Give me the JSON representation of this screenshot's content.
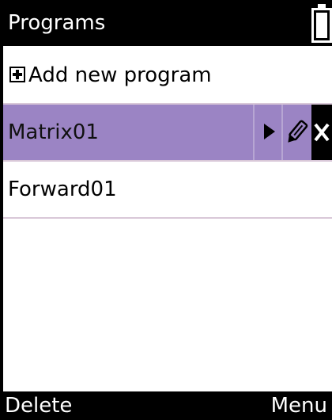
{
  "titlebar": {
    "title": "Programs",
    "battery_icon": "battery-full-icon"
  },
  "add_row": {
    "label": "Add new program",
    "icon": "plus-box-icon"
  },
  "programs": [
    {
      "name": "Matrix01",
      "selected": true,
      "actions": [
        "play-icon",
        "pencil-icon",
        "close-icon"
      ]
    },
    {
      "name": "Forward01",
      "selected": false
    }
  ],
  "softkeys": {
    "left": "Delete",
    "right": "Menu"
  },
  "colors": {
    "selected_row": "#9b84c4",
    "bar_background": "#000000",
    "divider": "#d9c8d8"
  }
}
